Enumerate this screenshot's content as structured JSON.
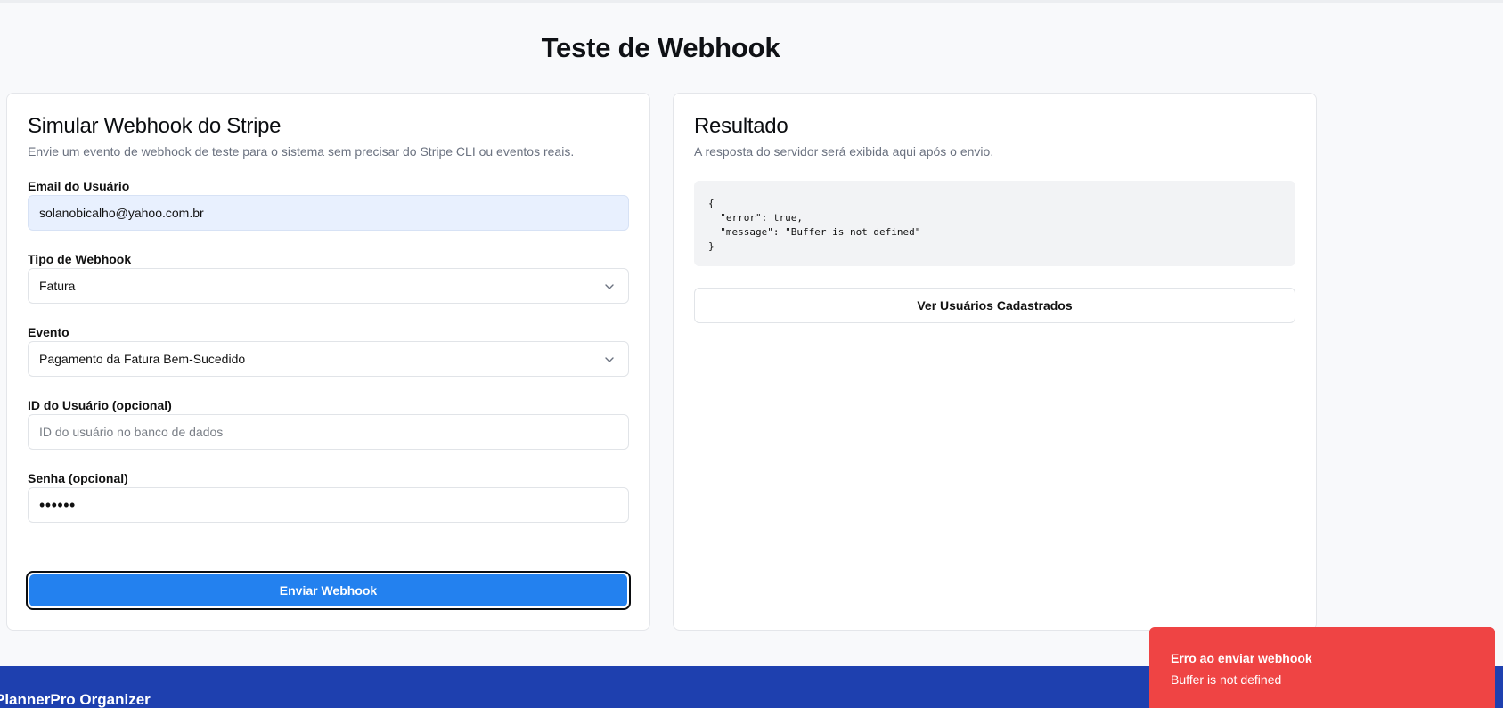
{
  "page": {
    "title": "Teste de Webhook"
  },
  "form": {
    "title": "Simular Webhook do Stripe",
    "description": "Envie um evento de webhook de teste para o sistema sem precisar do Stripe CLI ou eventos reais.",
    "email": {
      "label": "Email do Usuário",
      "value": "solanobicalho@yahoo.com.br"
    },
    "webhook_type": {
      "label": "Tipo de Webhook",
      "value": "Fatura"
    },
    "event": {
      "label": "Evento",
      "value": "Pagamento da Fatura Bem-Sucedido"
    },
    "user_id": {
      "label": "ID do Usuário (opcional)",
      "placeholder": "ID do usuário no banco de dados",
      "value": ""
    },
    "password": {
      "label": "Senha (opcional)",
      "masked_value": "••••••"
    },
    "submit_label": "Enviar Webhook"
  },
  "result": {
    "title": "Resultado",
    "description": "A resposta do servidor será exibida aqui após o envio.",
    "response_json": "{\n  \"error\": true,\n  \"message\": \"Buffer is not defined\"\n}",
    "view_users_label": "Ver Usuários Cadastrados"
  },
  "footer": {
    "brand": "PlannerPro Organizer"
  },
  "toast": {
    "title": "Erro ao enviar webhook",
    "message": "Buffer is not defined",
    "color": "#ef4444"
  },
  "colors": {
    "primary": "#2381ef",
    "footer": "#1e40af",
    "error": "#ef4444"
  },
  "icons": {
    "select_chevron": "chevron-down-icon"
  }
}
